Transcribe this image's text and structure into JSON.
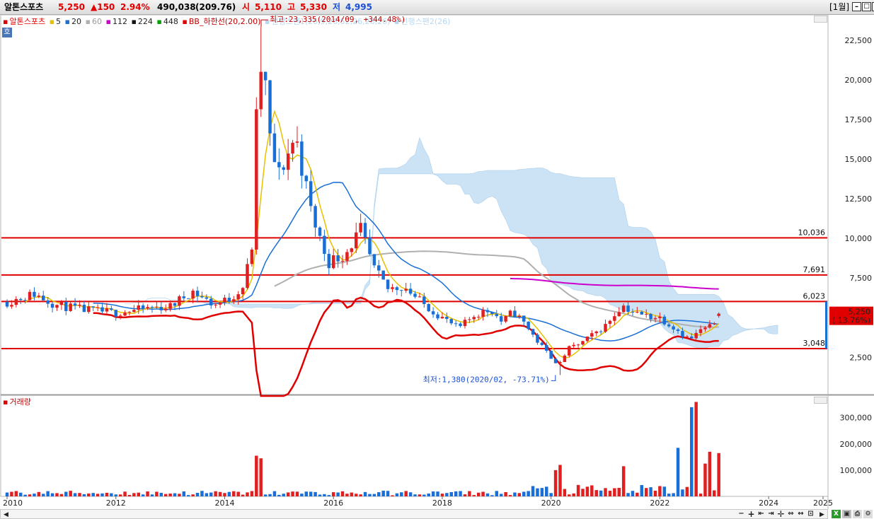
{
  "header": {
    "stock_name": "알톤스포츠",
    "price": "5,250",
    "change": "▲150",
    "change_pct": "2.94%",
    "volume": "490,038",
    "volume_ratio": "(209.76)",
    "open_label": "시",
    "open": "5,110",
    "high_label": "고",
    "high": "5,330",
    "low_label": "저",
    "low": "4,995",
    "period": "[1월]"
  },
  "legend": {
    "name": "알톤스포츠",
    "ma": [
      "5",
      "20",
      "60",
      "112",
      "224",
      "448"
    ],
    "ma_colors": [
      "#e8c000",
      "#1a6fd6",
      "#b0b0b0",
      "#cc00cc",
      "#111111",
      "#00a000"
    ],
    "bb": "BB_하한선(20,2.00)",
    "span1": "선행스팬1(26,9,26,52,26,26,26)",
    "span2": "선행스팬2(26)",
    "side_tag": "호",
    "volume_label": "거래량"
  },
  "annotations": {
    "max": "최고:23,335(2014/09, +344.48%)",
    "min": "최저:1,380(2020/02, -73.71%)"
  },
  "current_tag": {
    "price": "5,250",
    "pct": "( 13.76%)"
  },
  "colors": {
    "up": "#e02020",
    "down": "#1a6fd6",
    "cloud": "#c6e0f5",
    "level": "#e00000",
    "bb": "#e00000"
  },
  "chart_data": [
    {
      "type": "candlestick",
      "x_labels": [
        "2010",
        "2012",
        "2014",
        "2016",
        "2018",
        "2020",
        "2022",
        "2024",
        "2025"
      ],
      "x_range": [
        2010.0,
        2025.0
      ],
      "y_ticks": [
        "22,500",
        "20,000",
        "17,500",
        "15,000",
        "12,500",
        "10,000",
        "7,500",
        "5,000",
        "2,500"
      ],
      "y_values": [
        22500,
        20000,
        17500,
        15000,
        12500,
        10000,
        7500,
        5000,
        2500
      ],
      "ylim": [
        150,
        24100
      ],
      "levels": [
        {
          "value": 10036,
          "label": "10,036"
        },
        {
          "value": 7691,
          "label": "7,691"
        },
        {
          "value": 6023,
          "label": "6,023"
        },
        {
          "value": 3048,
          "label": "3,048"
        }
      ],
      "max_point": {
        "t": 2014.67,
        "value": 23335
      },
      "min_point": {
        "t": 2020.08,
        "value": 1380
      },
      "anchors": [
        [
          2010.0,
          6000
        ],
        [
          2010.5,
          6500
        ],
        [
          2010.9,
          5800
        ],
        [
          2011.4,
          5500
        ],
        [
          2012.0,
          5300
        ],
        [
          2012.6,
          5600
        ],
        [
          2013.0,
          5700
        ],
        [
          2013.4,
          6700
        ],
        [
          2013.8,
          5800
        ],
        [
          2014.1,
          6200
        ],
        [
          2014.35,
          7000
        ],
        [
          2014.5,
          9500
        ],
        [
          2014.6,
          19000
        ],
        [
          2014.7,
          21500
        ],
        [
          2014.85,
          15500
        ],
        [
          2015.0,
          14000
        ],
        [
          2015.3,
          16500
        ],
        [
          2015.6,
          11500
        ],
        [
          2015.9,
          8500
        ],
        [
          2016.2,
          9000
        ],
        [
          2016.5,
          10500
        ],
        [
          2016.75,
          8000
        ],
        [
          2017.0,
          6800
        ],
        [
          2017.3,
          7000
        ],
        [
          2017.6,
          6000
        ],
        [
          2018.0,
          5000
        ],
        [
          2018.3,
          4300
        ],
        [
          2018.6,
          5200
        ],
        [
          2018.9,
          5500
        ],
        [
          2019.1,
          4700
        ],
        [
          2019.3,
          5400
        ],
        [
          2019.55,
          4500
        ],
        [
          2019.75,
          3500
        ],
        [
          2020.0,
          2500
        ],
        [
          2020.15,
          2000
        ],
        [
          2020.3,
          3000
        ],
        [
          2020.6,
          3500
        ],
        [
          2021.0,
          4500
        ],
        [
          2021.3,
          5800
        ],
        [
          2021.6,
          5200
        ],
        [
          2022.0,
          5000
        ],
        [
          2022.3,
          4300
        ],
        [
          2022.55,
          3600
        ],
        [
          2022.75,
          4200
        ],
        [
          2022.93,
          4400
        ],
        [
          2023.1,
          5250
        ]
      ]
    },
    {
      "type": "bar",
      "title": "거래량",
      "y_ticks": [
        "300,000",
        "200,000",
        "100,000"
      ],
      "y_values": [
        300000,
        200000,
        100000
      ],
      "ylim": [
        0,
        380000
      ],
      "big_bars": [
        {
          "t": 2014.55,
          "value": 155000,
          "up": true
        },
        {
          "t": 2014.65,
          "value": 145000,
          "up": true
        },
        {
          "t": 2020.1,
          "value": 100000,
          "up": true
        },
        {
          "t": 2020.2,
          "value": 120000,
          "up": true
        },
        {
          "t": 2021.3,
          "value": 115000,
          "up": true
        },
        {
          "t": 2022.35,
          "value": 185000,
          "up": false
        },
        {
          "t": 2022.6,
          "value": 340000,
          "up": false
        },
        {
          "t": 2022.7,
          "value": 360000,
          "up": true
        },
        {
          "t": 2022.85,
          "value": 125000,
          "up": true
        },
        {
          "t": 2022.95,
          "value": 170000,
          "up": true
        },
        {
          "t": 2023.05,
          "value": 165000,
          "up": true
        }
      ]
    }
  ]
}
